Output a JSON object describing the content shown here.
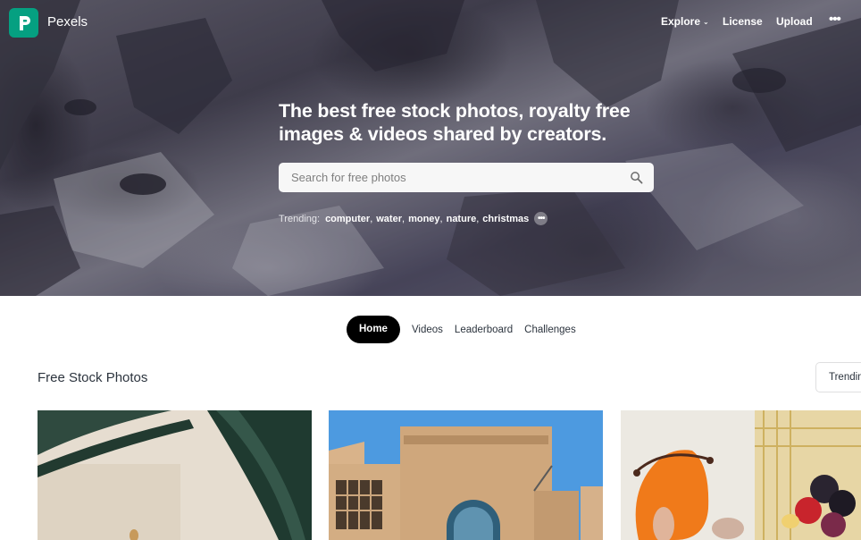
{
  "brand": {
    "name": "Pexels"
  },
  "nav": {
    "items": [
      {
        "label": "Explore",
        "has_dropdown": true
      },
      {
        "label": "License"
      },
      {
        "label": "Upload"
      }
    ],
    "more_icon": "ellipsis-icon"
  },
  "hero": {
    "headline": "The best free stock photos, royalty free images & videos shared by creators.",
    "search": {
      "placeholder": "Search for free photos",
      "icon": "search-icon"
    },
    "trending": {
      "label": "Trending:",
      "terms": [
        "computer",
        "water",
        "money",
        "nature",
        "christmas"
      ]
    }
  },
  "tabs": [
    {
      "label": "Home",
      "active": true
    },
    {
      "label": "Videos"
    },
    {
      "label": "Leaderboard"
    },
    {
      "label": "Challenges"
    }
  ],
  "section": {
    "title": "Free Stock Photos",
    "sort_label": "Trending"
  },
  "colors": {
    "brand": "#05a081",
    "active_tab": "#000000"
  }
}
